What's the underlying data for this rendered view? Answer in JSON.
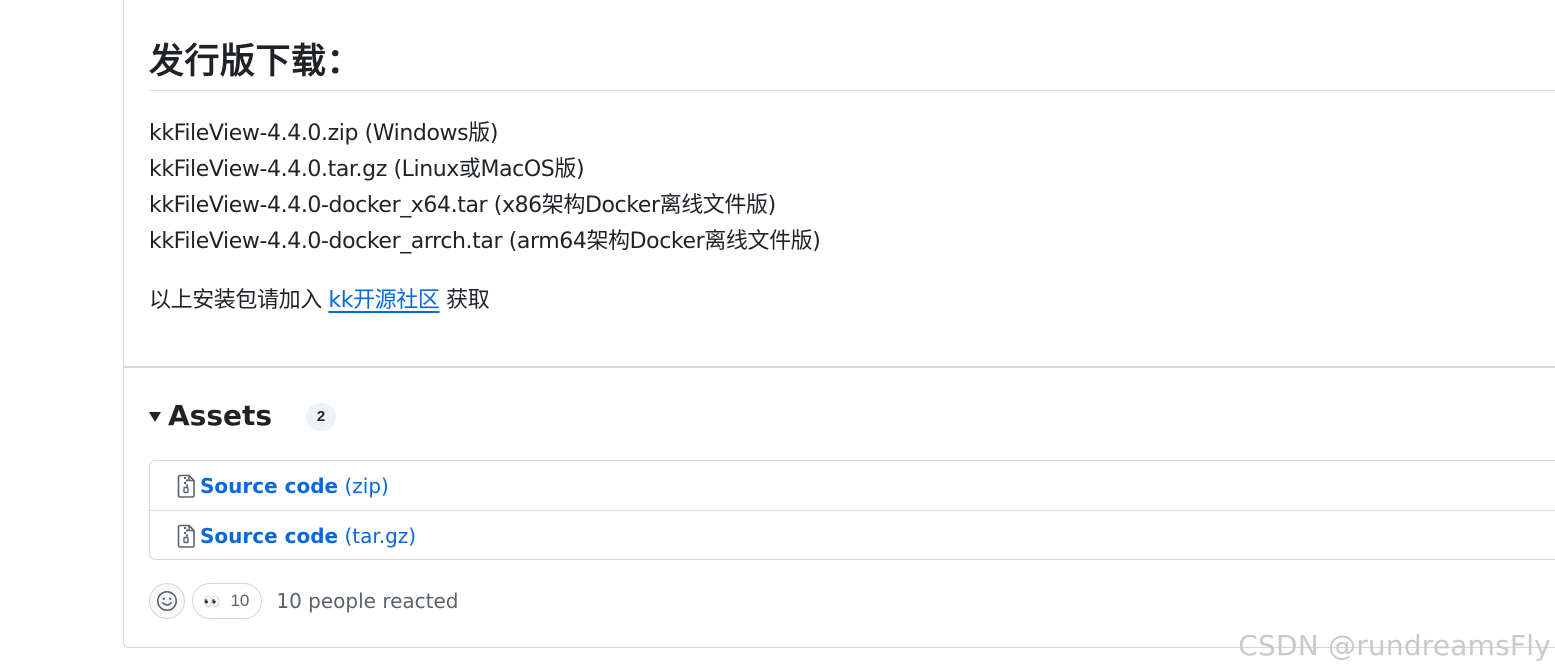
{
  "release": {
    "heading": "发行版下载：",
    "files": [
      "kkFileView-4.4.0.zip (Windows版)",
      "kkFileView-4.4.0.tar.gz (Linux或MacOS版)",
      "kkFileView-4.4.0-docker_x64.tar (x86架构Docker离线文件版)",
      "kkFileView-4.4.0-docker_arrch.tar (arm64架构Docker离线文件版)"
    ],
    "notice_prefix": "以上安装包请加入 ",
    "notice_link": "kk开源社区",
    "notice_suffix": " 获取"
  },
  "assets": {
    "title": "Assets",
    "count": "2",
    "items": [
      {
        "label": "Source code",
        "ext": " (zip)",
        "icon": "file-zip-icon"
      },
      {
        "label": "Source code",
        "ext": " (tar.gz)",
        "icon": "file-zip-icon"
      }
    ]
  },
  "reactions": {
    "smiley_icon": "smiley-icon",
    "eyes_emoji": "👀",
    "eyes_count": "10",
    "summary": "10 people reacted"
  },
  "watermark": "CSDN @rundreamsFly",
  "colors": {
    "link": "#0969da",
    "text": "#1f2328",
    "muted": "#59636e",
    "border": "#d0d7de"
  }
}
